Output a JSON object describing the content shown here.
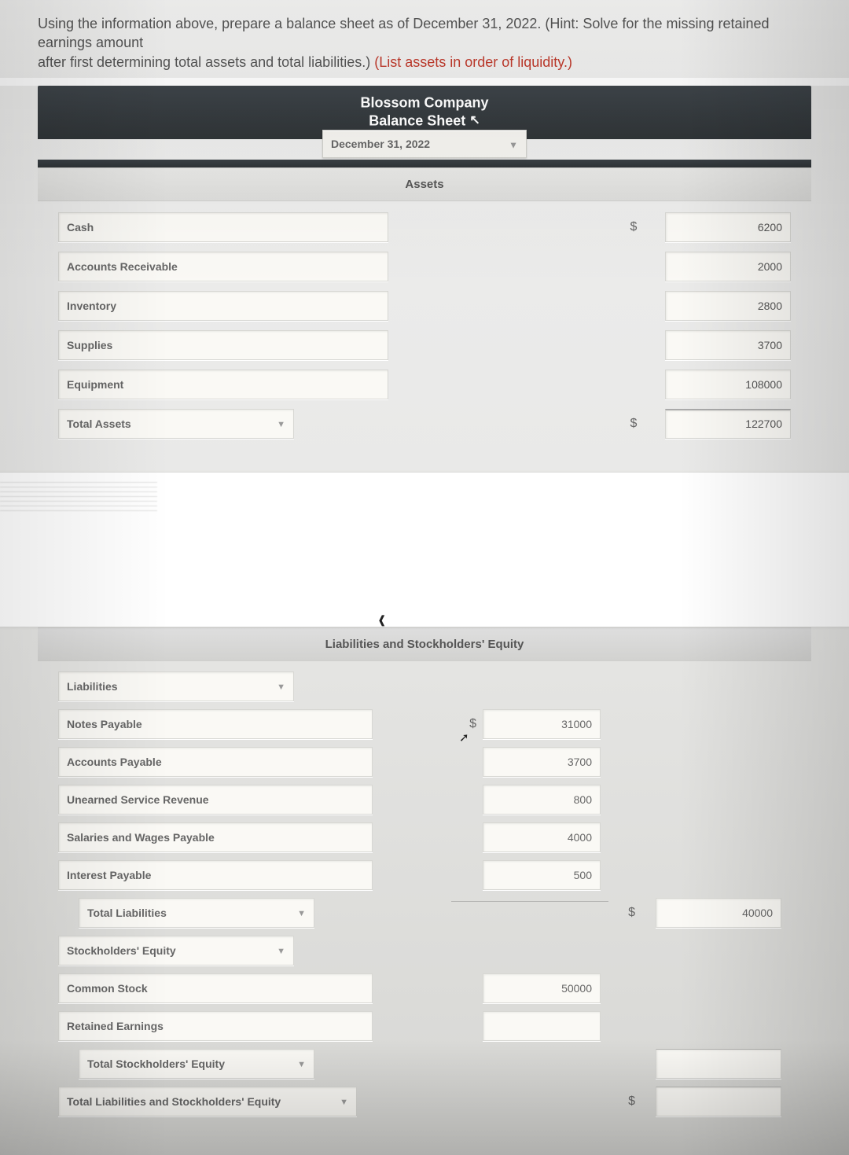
{
  "prompt": {
    "line1": "Using the information above, prepare a balance sheet as of December 31, 2022. (Hint: Solve for the missing retained earnings amount",
    "line2a": "after first determining total assets and total liabilities.) ",
    "hint": "(List assets in order of liquidity.)"
  },
  "header": {
    "company": "Blossom Company",
    "statement": "Balance Sheet",
    "date": "December 31, 2022"
  },
  "sections": {
    "assets": "Assets",
    "liab_eq": "Liabilities and Stockholders' Equity"
  },
  "assets": {
    "rows": [
      {
        "label": "Cash",
        "amount": "6200",
        "show_sym": true
      },
      {
        "label": "Accounts Receivable",
        "amount": "2000",
        "show_sym": false
      },
      {
        "label": "Inventory",
        "amount": "2800",
        "show_sym": false
      },
      {
        "label": "Supplies",
        "amount": "3700",
        "show_sym": false
      },
      {
        "label": "Equipment",
        "amount": "108000",
        "show_sym": false
      }
    ],
    "total_label": "Total Assets",
    "total_amount": "122700"
  },
  "liabilities": {
    "heading": "Liabilities",
    "rows": [
      {
        "label": "Notes Payable",
        "amount": "31000",
        "show_sym": true
      },
      {
        "label": "Accounts Payable",
        "amount": "3700",
        "show_sym": false
      },
      {
        "label": "Unearned Service Revenue",
        "amount": "800",
        "show_sym": false
      },
      {
        "label": "Salaries and Wages Payable",
        "amount": "4000",
        "show_sym": false
      },
      {
        "label": "Interest Payable",
        "amount": "500",
        "show_sym": false
      }
    ],
    "total_label": "Total Liabilities",
    "total_amount": "40000"
  },
  "equity": {
    "heading": "Stockholders' Equity",
    "common_stock_label": "Common Stock",
    "common_stock_amount": "50000",
    "retained_label": "Retained Earnings",
    "retained_amount": "",
    "total_eq_label": "Total Stockholders' Equity",
    "total_eq_amount": "",
    "grand_total_label": "Total Liabilities and Stockholders' Equity",
    "grand_total_amount": ""
  },
  "symbols": {
    "dollar": "$"
  }
}
